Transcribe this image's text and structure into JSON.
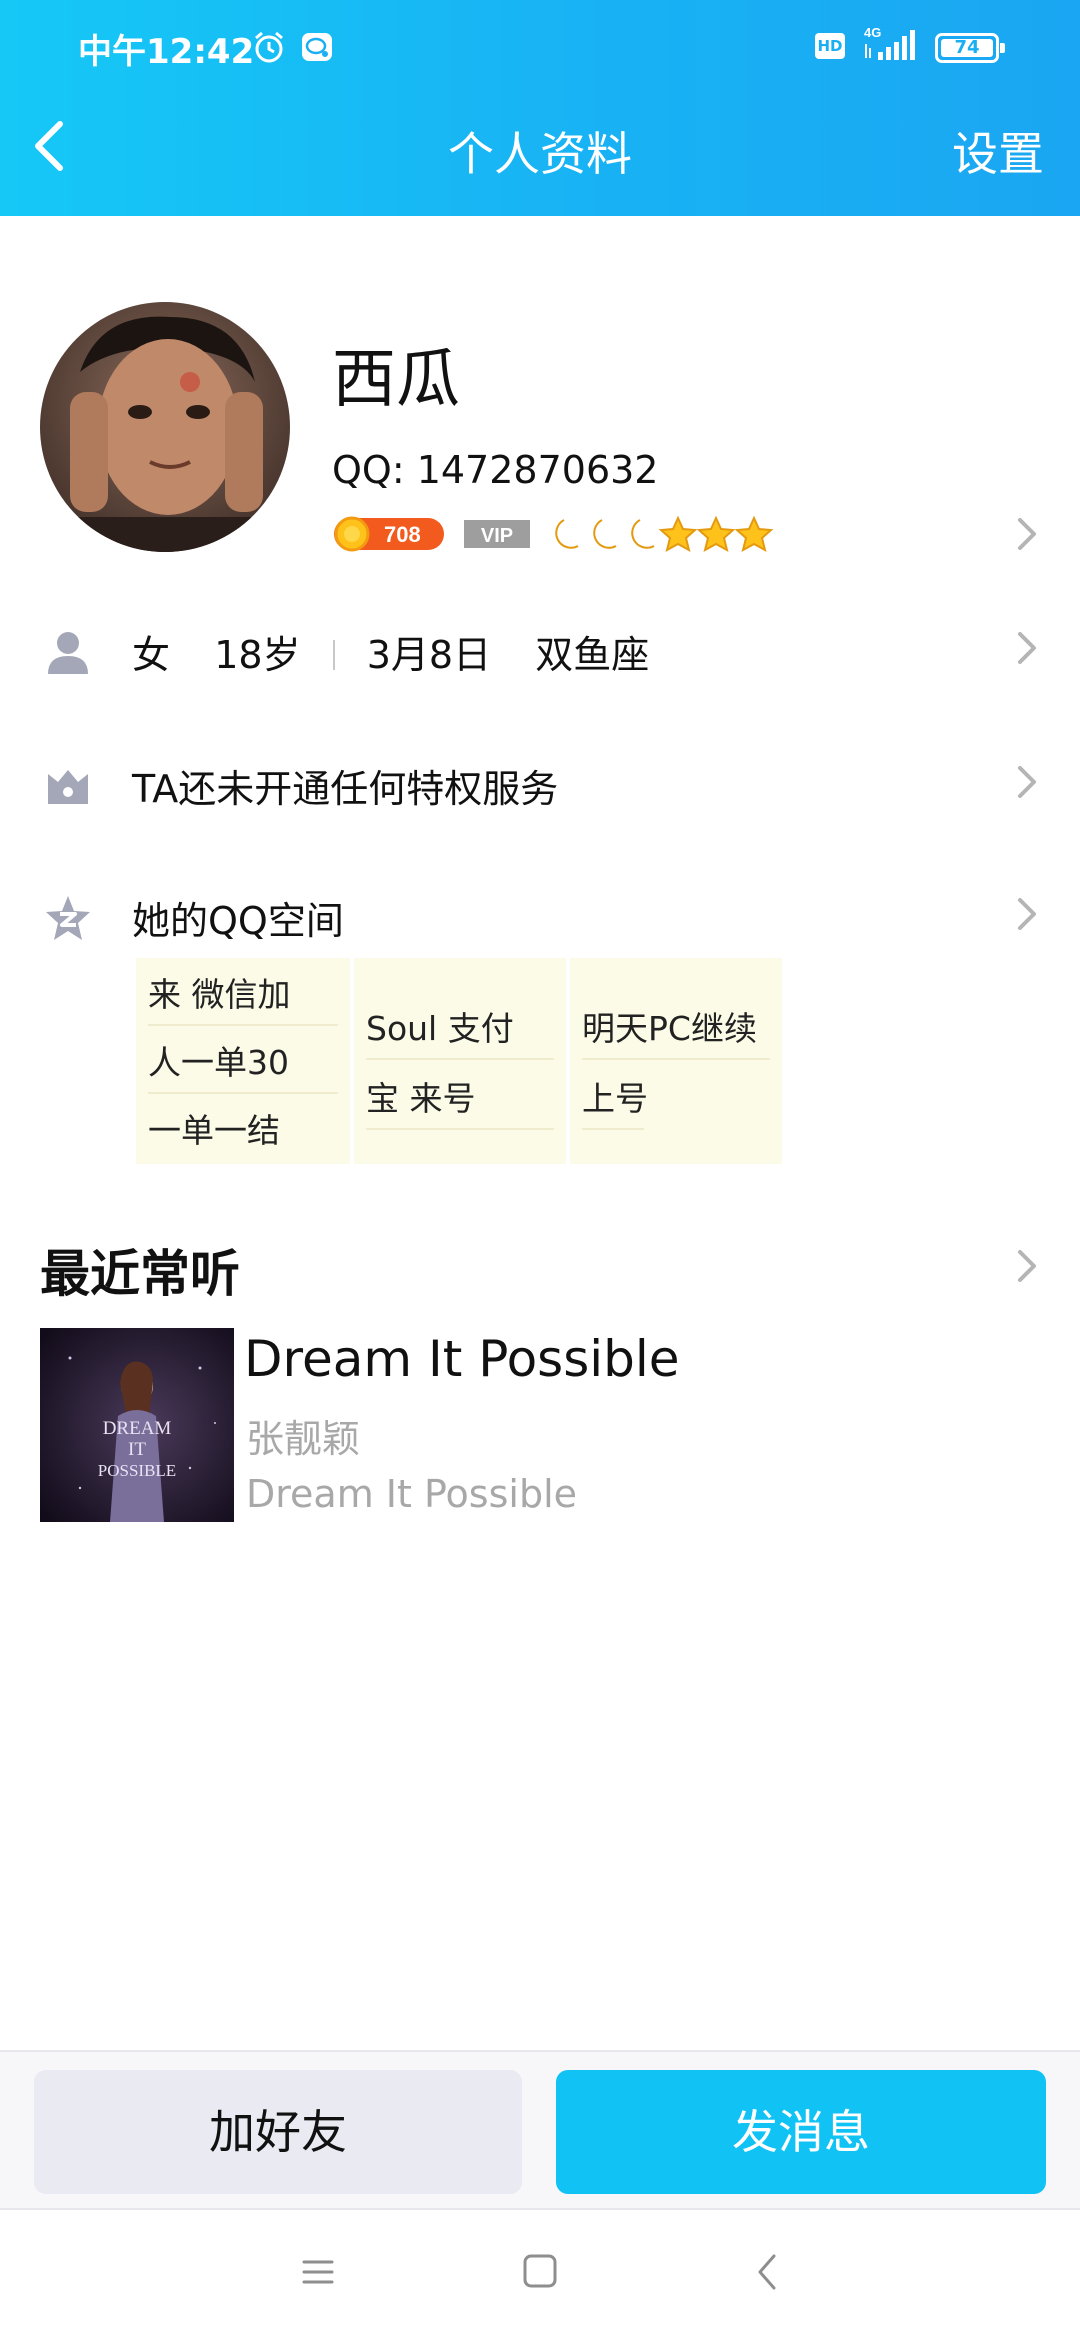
{
  "status_bar": {
    "time": "中午12:42",
    "hd_label": "HD",
    "network": "4G",
    "battery": "74",
    "icons": [
      "alarm-icon",
      "chat-notification-icon",
      "signal-icon",
      "battery-icon"
    ]
  },
  "nav": {
    "title": "个人资料",
    "settings_label": "设置"
  },
  "profile": {
    "name": "西瓜",
    "qq_label": "QQ: 1472870632",
    "coin_count": "708",
    "vip_label": "VIP",
    "level_icons": [
      "moon-icon",
      "moon-icon",
      "moon-icon",
      "star-icon",
      "star-icon",
      "star-icon"
    ]
  },
  "info": {
    "gender": "女",
    "age": "18岁",
    "birthday": "3月8日",
    "zodiac": "双鱼座",
    "privilege_text": "TA还未开通任何特权服务",
    "qzone_label": "她的QQ空间"
  },
  "qzone_notes": [
    {
      "lines": [
        "来  微信加",
        "人一单30",
        "一单一结"
      ]
    },
    {
      "lines": [
        "Soul     支付",
        "宝    来号"
      ]
    },
    {
      "lines": [
        "明天PC继续",
        "上号"
      ]
    }
  ],
  "music": {
    "section_title": "最近常听",
    "song_title": "Dream It Possible",
    "artist": "张靓颖",
    "album": "Dream It Possible",
    "cover_text": "DREAM IT POSSIBLE"
  },
  "actions": {
    "add_friend": "加好友",
    "send_message": "发消息"
  },
  "colors": {
    "header_start": "#15c8f6",
    "header_end": "#1aa6f2",
    "primary_button": "#11c2f5",
    "secondary_button": "#e9eaf2"
  }
}
